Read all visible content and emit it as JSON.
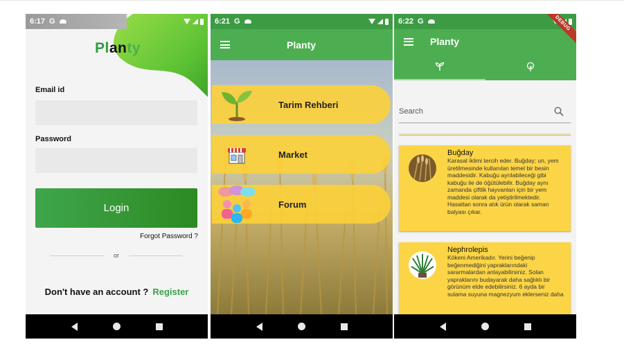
{
  "phone1": {
    "status": {
      "time": "6:17",
      "carrier": "G"
    },
    "brand": {
      "part1": "Pl",
      "part2": "an",
      "part3": "ty"
    },
    "email_label": "Email id",
    "password_label": "Password",
    "login_label": "Login",
    "forgot_label": "Forgot Password ?",
    "or_label": "or",
    "no_account_label": "Don't have an account ?",
    "register_label": "Register"
  },
  "phone2": {
    "status": {
      "time": "6:21",
      "carrier": "G"
    },
    "title": "Planty",
    "menu": [
      {
        "label": "Tarim Rehberi",
        "icon": "sprout-icon"
      },
      {
        "label": "Market",
        "icon": "store-icon"
      },
      {
        "label": "Forum",
        "icon": "people-chat-icon"
      }
    ]
  },
  "phone3": {
    "status": {
      "time": "6:22",
      "carrier": "G"
    },
    "title": "Planty",
    "debug_banner": "DEBUG",
    "tabs": [
      {
        "icon": "seedling-icon",
        "selected": true
      },
      {
        "icon": "tree-icon",
        "selected": false
      }
    ],
    "search": {
      "placeholder": "Search"
    },
    "plants": [
      {
        "name": "Buğday",
        "description": "Karasal iklimi tercih eder. Buğday; un, yem üretilmesinde kullanılan temel bir besin maddesidir. Kabuğu ayrılabileceği gibi kabuğu ile de öğütülebilir. Buğday aynı zamanda çiftlik hayvanları için bir yem maddesi olarak da yetiştirilmektedir. Hasattan sonra atık ürün olarak saman balyası çıkar."
      },
      {
        "name": "Nephrolepis",
        "description": "Kökeni Amerikadır. Yerini beğenip beğenmediğini yapraklarındaki sararmalardan anlayabilirsiniz. Solan yapraklarını budayarak daha sağlıklı bir görünüm elde edebilirsiniz. 6 ayda bir sulama suyuna magnezyum eklerseniz daha"
      }
    ]
  },
  "colors": {
    "primary_green": "#4cae50",
    "status_green": "#3c9b43",
    "card_yellow": "#fcd546",
    "register_green": "#3aa04a"
  }
}
